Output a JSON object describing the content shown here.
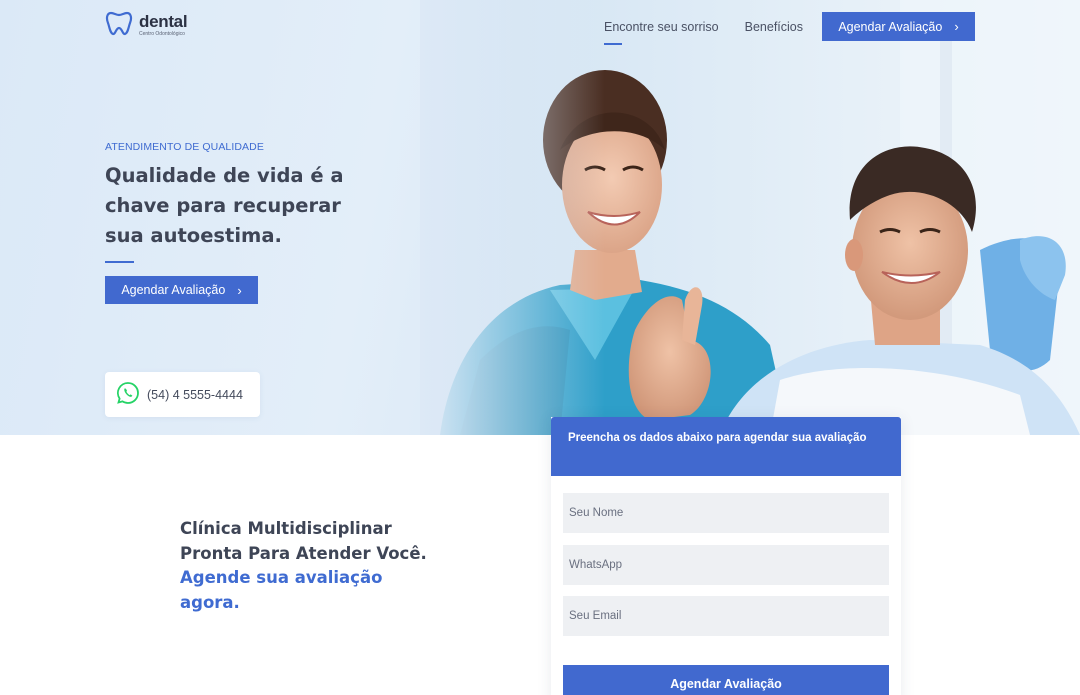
{
  "header": {
    "logo_name": "dental",
    "logo_subtitle": "Centro Odontológico",
    "nav": [
      {
        "label": "Encontre seu sorriso"
      },
      {
        "label": "Benefícios"
      }
    ],
    "cta_label": "Agendar Avaliação",
    "cta_chevron": "›"
  },
  "hero": {
    "eyebrow": "ATENDIMENTO DE QUALIDADE",
    "title": "Qualidade de vida é a chave para recuperar sua autoestima.",
    "button_label": "Agendar Avaliação",
    "button_chevron": "›",
    "phone": "(54) 4 5555-4444"
  },
  "cta": {
    "line_dark": "Clínica Multidisciplinar Pronta Para Atender Você.",
    "line_blue": "Agende sua avaliação agora."
  },
  "form": {
    "heading": "Preencha os dados abaixo para agendar sua avaliação",
    "name_placeholder": "Seu Nome",
    "whatsapp_placeholder": "WhatsApp",
    "email_placeholder": "Seu Email",
    "submit_label": "Agendar Avaliação"
  },
  "colors": {
    "accent": "#4169cf",
    "heading": "#3e4556",
    "whatsapp": "#25d366"
  },
  "icons": [
    "tooth-logo-icon",
    "chevron-right-icon",
    "whatsapp-icon"
  ]
}
